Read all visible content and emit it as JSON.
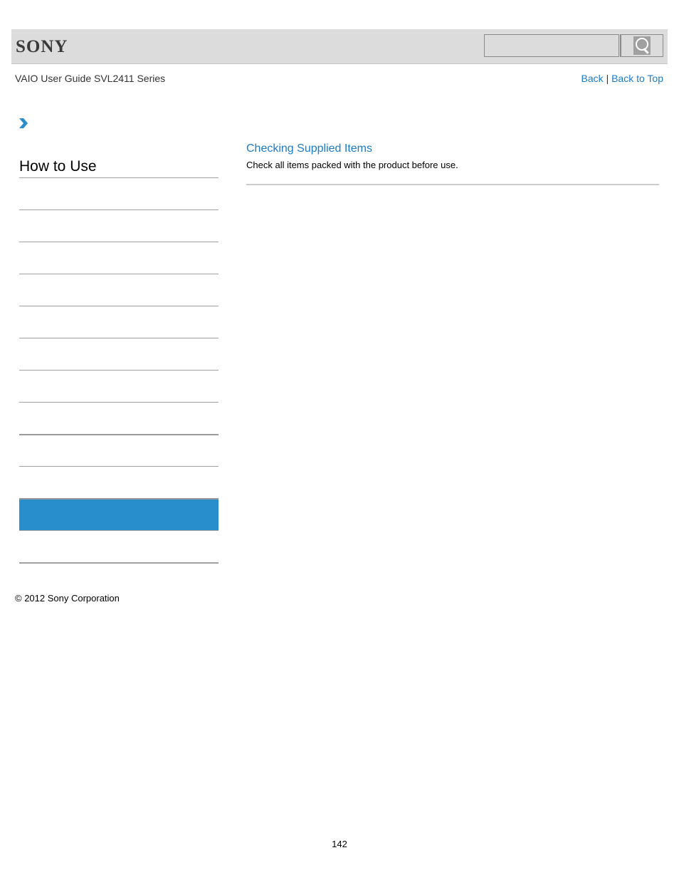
{
  "header": {
    "brand": "SONY",
    "search": {
      "placeholder": "",
      "value": ""
    },
    "search_icon": "magnifier-icon"
  },
  "subheader": {
    "guide_title": "VAIO User Guide SVL2411 Series",
    "links": {
      "back": "Back",
      "separator": "|",
      "back_to_top": "Back to Top"
    }
  },
  "sidebar": {
    "breadcrumb_icon": "chevron-right-icon",
    "section_title": "How to Use",
    "items": [
      {
        "label": "",
        "active": false
      },
      {
        "label": "",
        "active": false
      },
      {
        "label": "",
        "active": false
      },
      {
        "label": "",
        "active": false
      },
      {
        "label": "",
        "active": false
      },
      {
        "label": "",
        "active": false
      },
      {
        "label": "",
        "active": false
      },
      {
        "label": "",
        "active": false
      },
      {
        "label": "",
        "active": false
      },
      {
        "label": "",
        "active": false
      },
      {
        "label": "",
        "active": true
      },
      {
        "label": "",
        "active": false
      }
    ],
    "active_color": "#288ecc"
  },
  "content": {
    "topics": [
      {
        "title": "Checking Supplied Items",
        "description": "Check all items packed with the product before use."
      }
    ],
    "link_color": "#1a7cc8"
  },
  "footer": {
    "copyright": "© 2012 Sony Corporation",
    "page_number": "142"
  }
}
